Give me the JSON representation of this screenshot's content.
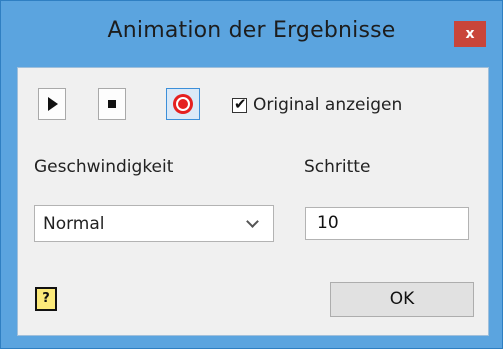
{
  "window": {
    "title": "Animation der Ergebnisse",
    "close_label": "x"
  },
  "toolbar": {
    "play_icon": "play-icon",
    "stop_icon": "stop-icon",
    "record_icon": "record-icon"
  },
  "original_checkbox": {
    "label": "Original anzeigen",
    "checked": true,
    "check_glyph": "✔"
  },
  "speed": {
    "label": "Geschwindigkeit",
    "selected": "Normal"
  },
  "steps": {
    "label": "Schritte",
    "value": "10"
  },
  "help": {
    "glyph": "?"
  },
  "ok_label": "OK",
  "colors": {
    "titlebar": "#5ba4df",
    "close_button": "#c9453a",
    "record": "#e52020",
    "help_icon_bg": "#fbe97a"
  }
}
